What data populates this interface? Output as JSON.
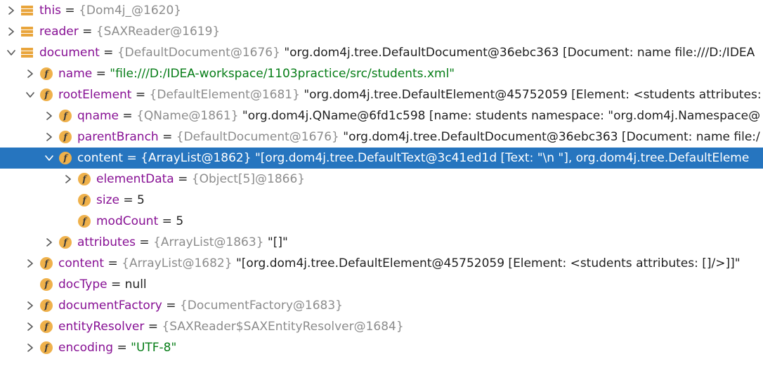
{
  "colors": {
    "selection": "#2675bf",
    "field_icon": "#efb14b",
    "local_icon": "#e9a53c",
    "name": "#871094",
    "type_ref": "#8c8c8c",
    "string_value": "#067d17"
  },
  "rows": [
    {
      "depth": 0,
      "toggle": "collapsed",
      "icon": "local-variable-icon",
      "name": "this",
      "eq": " = ",
      "ref": "{Dom4j_@1620}",
      "value": "",
      "value_kind": "plain",
      "selected": false
    },
    {
      "depth": 0,
      "toggle": "collapsed",
      "icon": "local-variable-icon",
      "name": "reader",
      "eq": " = ",
      "ref": "{SAXReader@1619}",
      "value": "",
      "value_kind": "plain",
      "selected": false
    },
    {
      "depth": 0,
      "toggle": "expanded",
      "icon": "local-variable-icon",
      "name": "document",
      "eq": " = ",
      "ref": "{DefaultDocument@1676}",
      "value": " \"org.dom4j.tree.DefaultDocument@36ebc363 [Document: name file:///D:/IDEA",
      "value_kind": "plain",
      "selected": false
    },
    {
      "depth": 1,
      "toggle": "collapsed",
      "icon": "field-icon",
      "name": "name",
      "eq": " = ",
      "ref": "",
      "value": "\"file:///D:/IDEA-workspace/1103practice/src/students.xml\"",
      "value_kind": "string",
      "selected": false
    },
    {
      "depth": 1,
      "toggle": "expanded",
      "icon": "field-icon",
      "name": "rootElement",
      "eq": " = ",
      "ref": "{DefaultElement@1681}",
      "value": " \"org.dom4j.tree.DefaultElement@45752059 [Element: <students attributes:",
      "value_kind": "plain",
      "selected": false
    },
    {
      "depth": 2,
      "toggle": "collapsed",
      "icon": "field-icon",
      "name": "qname",
      "eq": " = ",
      "ref": "{QName@1861}",
      "value": " \"org.dom4j.QName@6fd1c598 [name: students namespace: \"org.dom4j.Namespace@",
      "value_kind": "plain",
      "selected": false
    },
    {
      "depth": 2,
      "toggle": "collapsed",
      "icon": "field-icon",
      "name": "parentBranch",
      "eq": " = ",
      "ref": "{DefaultDocument@1676}",
      "value": " \"org.dom4j.tree.DefaultDocument@36ebc363 [Document: name file:/",
      "value_kind": "plain",
      "selected": false
    },
    {
      "depth": 2,
      "toggle": "expanded",
      "icon": "field-icon",
      "name": "content",
      "eq": " = ",
      "ref": "{ArrayList@1862}",
      "value": " \"[org.dom4j.tree.DefaultText@3c41ed1d [Text: \"\\n    \"], org.dom4j.tree.DefaultEleme",
      "value_kind": "plain",
      "selected": true
    },
    {
      "depth": 3,
      "toggle": "collapsed",
      "icon": "field-icon",
      "name": "elementData",
      "eq": " = ",
      "ref": "{Object[5]@1866}",
      "value": "",
      "value_kind": "plain",
      "selected": false
    },
    {
      "depth": 3,
      "toggle": "none",
      "icon": "field-icon",
      "name": "size",
      "eq": " = ",
      "ref": "",
      "value": "5",
      "value_kind": "plain",
      "selected": false
    },
    {
      "depth": 3,
      "toggle": "none",
      "icon": "field-icon",
      "name": "modCount",
      "eq": " = ",
      "ref": "",
      "value": "5",
      "value_kind": "plain",
      "selected": false
    },
    {
      "depth": 2,
      "toggle": "collapsed",
      "icon": "field-icon",
      "name": "attributes",
      "eq": " = ",
      "ref": "{ArrayList@1863}",
      "value": " \"[]\"",
      "value_kind": "plain",
      "selected": false
    },
    {
      "depth": 1,
      "toggle": "collapsed",
      "icon": "field-icon",
      "name": "content",
      "eq": " = ",
      "ref": "{ArrayList@1682}",
      "value": " \"[org.dom4j.tree.DefaultElement@45752059 [Element: <students attributes: []/>]]\"",
      "value_kind": "plain",
      "selected": false
    },
    {
      "depth": 1,
      "toggle": "none",
      "icon": "field-icon",
      "name": "docType",
      "eq": " = ",
      "ref": "",
      "value": "null",
      "value_kind": "plain",
      "selected": false
    },
    {
      "depth": 1,
      "toggle": "collapsed",
      "icon": "field-icon",
      "name": "documentFactory",
      "eq": " = ",
      "ref": "{DocumentFactory@1683}",
      "value": "",
      "value_kind": "plain",
      "selected": false
    },
    {
      "depth": 1,
      "toggle": "collapsed",
      "icon": "field-icon",
      "name": "entityResolver",
      "eq": " = ",
      "ref": "{SAXReader$SAXEntityResolver@1684}",
      "value": "",
      "value_kind": "plain",
      "selected": false
    },
    {
      "depth": 1,
      "toggle": "collapsed",
      "icon": "field-icon",
      "name": "encoding",
      "eq": " = ",
      "ref": "",
      "value": "\"UTF-8\"",
      "value_kind": "string",
      "selected": false
    }
  ]
}
